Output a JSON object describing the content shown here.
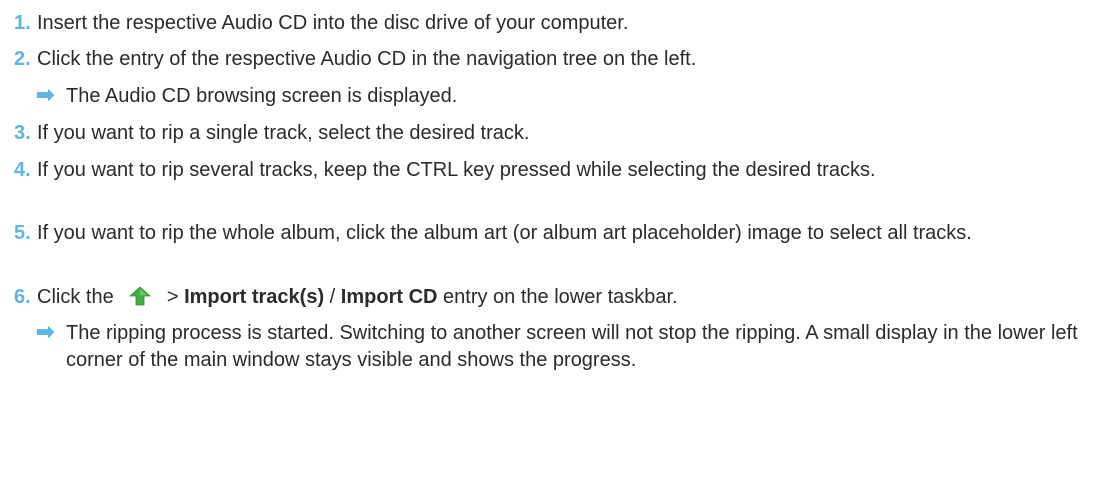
{
  "steps": [
    {
      "num": "1.",
      "text": "Insert the respective Audio CD into the disc drive of your computer."
    },
    {
      "num": "2.",
      "text": "Click the entry of the respective Audio CD in the navigation tree on the left."
    },
    {
      "num": "3.",
      "text": "If you want to rip a single track, select the desired track."
    },
    {
      "num": "4.",
      "text": "If you want to rip several tracks, keep the CTRL key pressed while selecting the desired tracks."
    },
    {
      "num": "5.",
      "text": "If you want to rip the whole album, click the album art (or album art placeholder) image to select all tracks."
    },
    {
      "num": "6.",
      "prefix": "Click the",
      "sep1": ">",
      "bold1": "Import track(s)",
      "sep2": "/",
      "bold2": "Import CD",
      "suffix": "entry on the lower taskbar."
    }
  ],
  "results": [
    {
      "arrow": "➡",
      "text": "The Audio CD browsing screen is displayed."
    },
    {
      "arrow": "➡",
      "text": "The ripping process is started. Switching to another screen will not stop the ripping. A small display in the lower left corner of the main window stays visible and shows the progress."
    }
  ],
  "icons": {
    "step6_icon": "green-up-arrow-icon"
  },
  "colors": {
    "number": "#5fb4e3",
    "arrow": "#5fb4e3",
    "text": "#2b2b2b",
    "icon": "#3fae3f"
  }
}
